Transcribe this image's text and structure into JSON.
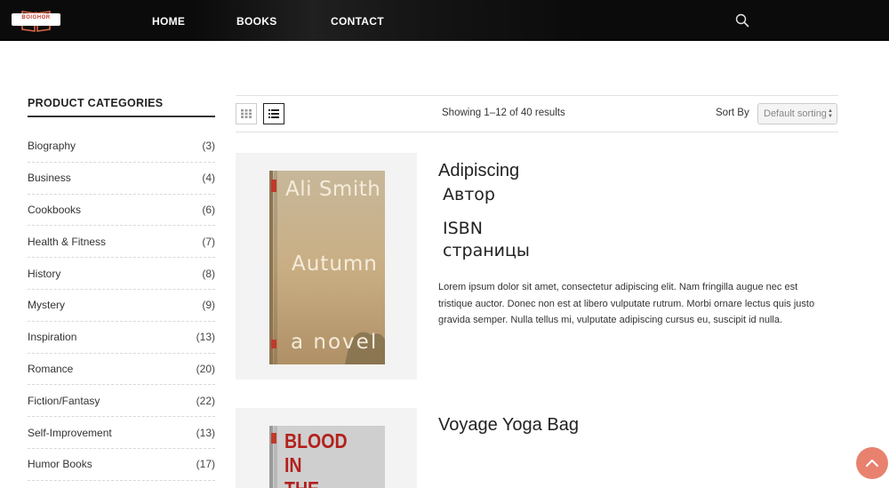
{
  "header": {
    "logo_text": "BOIGHOR",
    "nav": [
      "HOME",
      "BOOKS",
      "CONTACT"
    ]
  },
  "sidebar": {
    "title": "PRODUCT CATEGORIES",
    "categories": [
      {
        "name": "Biography",
        "count": "(3)"
      },
      {
        "name": "Business",
        "count": "(4)"
      },
      {
        "name": "Cookbooks",
        "count": "(6)"
      },
      {
        "name": "Health & Fitness",
        "count": "(7)"
      },
      {
        "name": "History",
        "count": "(8)"
      },
      {
        "name": "Mystery",
        "count": "(9)"
      },
      {
        "name": "Inspiration",
        "count": "(13)"
      },
      {
        "name": "Romance",
        "count": "(20)"
      },
      {
        "name": "Fiction/Fantasy",
        "count": "(22)"
      },
      {
        "name": "Self-Improvement",
        "count": "(13)"
      },
      {
        "name": "Humor Books",
        "count": "(17)"
      }
    ]
  },
  "toolbar": {
    "results_text": "Showing 1–12 of 40 results",
    "sort_label": "Sort By",
    "sort_value": "Default sorting"
  },
  "products": [
    {
      "title": "Adipiscing",
      "author_label": "Автор",
      "isbn_label": "ISBN",
      "pages_label": "страницы",
      "description": "Lorem ipsum dolor sit amet, consectetur adipiscing elit. Nam fringilla augue nec est tristique auctor. Donec non est at libero vulputate rutrum. Morbi ornare lectus quis justo gravida semper. Nulla tellus mi, vulputate adipiscing cursus eu, suscipit id nulla.",
      "cover": {
        "author": "Ali Smith",
        "title": "Autumn",
        "subtitle": "a novel"
      }
    },
    {
      "title": "Voyage Yoga Bag",
      "cover": {
        "line1": "BLOOD",
        "line2": "IN",
        "line3": "THE"
      }
    }
  ],
  "colors": {
    "header_bg": "#0b0b0b",
    "accent": "#e8826f",
    "logo_red": "#c0392b"
  },
  "icons": {
    "search": "search-icon",
    "grid_view": "grid-icon",
    "list_view": "list-icon",
    "scroll_top": "chevron-up-icon"
  }
}
